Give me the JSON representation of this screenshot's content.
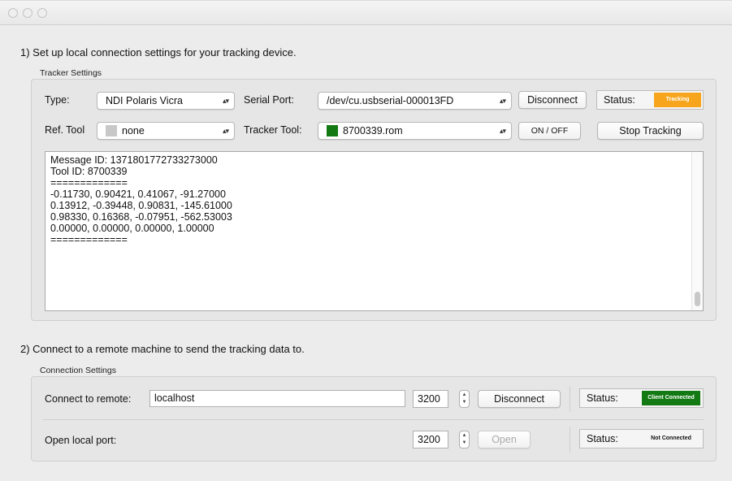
{
  "section1": {
    "heading": "1) Set up local connection settings for your tracking device.",
    "group_label": "Tracker Settings",
    "type_label": "Type:",
    "type_value": "NDI Polaris Vicra",
    "serial_label": "Serial Port:",
    "serial_value": "/dev/cu.usbserial-000013FD",
    "disconnect_label": "Disconnect",
    "status_label": "Status:",
    "status_value": "Tracking",
    "status_color": "#f7a51c",
    "ref_label": "Ref. Tool",
    "ref_value": "none",
    "ref_swatch_color": "#c8c8c8",
    "tool_label": "Tracker Tool:",
    "tool_value": "8700339.rom",
    "tool_swatch_color": "#137a13",
    "onoff_label": "ON / OFF",
    "stop_label": "Stop Tracking",
    "log_lines": [
      "Message ID: 1371801772733273000",
      "Tool ID: 8700339",
      "=============",
      "-0.11730, 0.90421, 0.41067, -91.27000",
      "0.13912, -0.39448, 0.90831, -145.61000",
      "0.98330, 0.16368, -0.07951, -562.53003",
      "0.00000, 0.00000, 0.00000, 1.00000",
      "============="
    ]
  },
  "section2": {
    "heading": "2) Connect to a remote machine to send the tracking data to.",
    "group_label": "Connection Settings",
    "remote_label": "Connect to remote:",
    "remote_value": "localhost",
    "remote_port": "3200",
    "remote_button": "Disconnect",
    "remote_status_label": "Status:",
    "remote_status_value": "Client Connected",
    "remote_status_color": "#137a13",
    "local_label": "Open local port:",
    "local_port": "3200",
    "local_button": "Open",
    "local_status_label": "Status:",
    "local_status_value": "Not Connected"
  }
}
